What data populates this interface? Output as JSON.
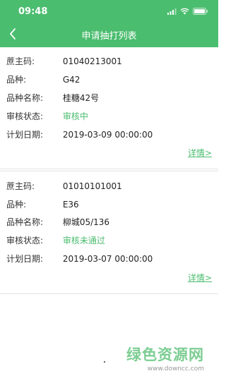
{
  "status_bar": {
    "time": "09:48"
  },
  "nav": {
    "title": "申请抽打列表"
  },
  "labels": {
    "cane_code": "蔗主码:",
    "variety": "品种:",
    "variety_name": "品种名称:",
    "audit_status": "审核状态:",
    "plan_date": "计划日期:",
    "detail_link": "详情>"
  },
  "records": [
    {
      "cane_code": "01040213001",
      "variety": "G42",
      "variety_name": "桂糖42号",
      "audit_status": "审核中",
      "plan_date": "2019-03-09 00:00:00"
    },
    {
      "cane_code": "01010101001",
      "variety": "E36",
      "variety_name": "柳城05/136",
      "audit_status": "审核未通过",
      "plan_date": "2019-03-07 00:00:00"
    }
  ],
  "watermark": {
    "main": "绿色资源网",
    "sub": "www.downcc.com"
  },
  "colors": {
    "accent": "#4bbd6f",
    "status_text": "#4bbd6f"
  }
}
